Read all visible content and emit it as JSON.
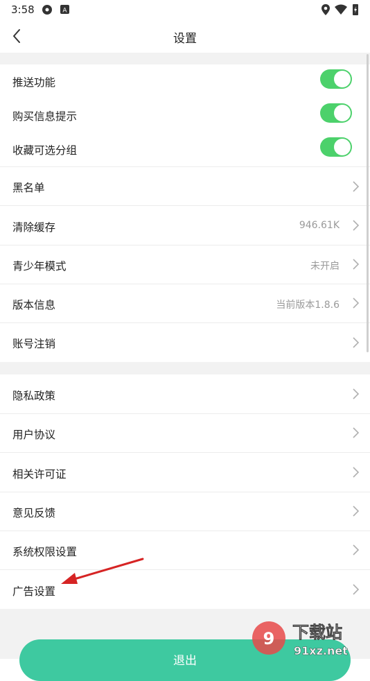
{
  "status_bar": {
    "time": "3:58"
  },
  "header": {
    "title": "设置"
  },
  "section1": [
    {
      "label": "推送功能",
      "toggle": true
    },
    {
      "label": "购买信息提示",
      "toggle": true
    },
    {
      "label": "收藏可选分组",
      "toggle": true
    }
  ],
  "section2": [
    {
      "label": "黑名单",
      "value": ""
    },
    {
      "label": "清除缓存",
      "value": "946.61K"
    },
    {
      "label": "青少年模式",
      "value": "未开启"
    },
    {
      "label": "版本信息",
      "value": "当前版本1.8.6"
    },
    {
      "label": "账号注销",
      "value": ""
    }
  ],
  "section3": [
    {
      "label": "隐私政策"
    },
    {
      "label": "用户协议"
    },
    {
      "label": "相关许可证"
    },
    {
      "label": "意见反馈"
    },
    {
      "label": "系统权限设置"
    },
    {
      "label": "广告设置"
    }
  ],
  "logout": {
    "label": "退出"
  },
  "watermark": {
    "text1": "下载站",
    "text2": "91xz.net"
  },
  "colors": {
    "toggle_on": "#4cd16b",
    "logout_bg": "#3ec9a0",
    "annotation_arrow": "#d62424"
  }
}
